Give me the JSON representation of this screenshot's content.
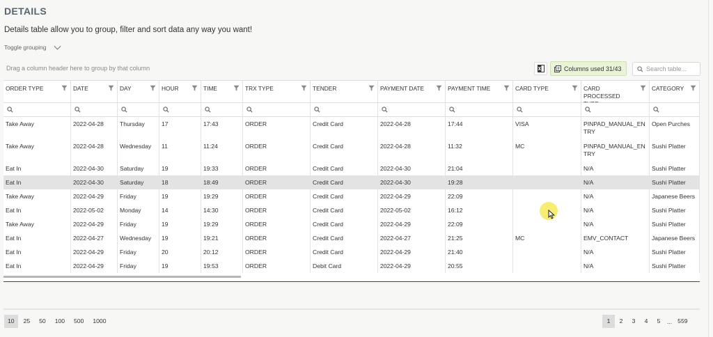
{
  "page": {
    "title": "DETAILS",
    "subtitle": "Details table allow you to group, filter and sort data any way you want!",
    "toggle_label": "Toggle grouping"
  },
  "toolbar": {
    "group_hint": "Drag a column header here to group by that column",
    "columns_label": "Columns used 31/43",
    "search_placeholder": "Search table..."
  },
  "columns": [
    {
      "label": "ORDER TYPE"
    },
    {
      "label": "DATE"
    },
    {
      "label": "DAY"
    },
    {
      "label": "HOUR"
    },
    {
      "label": "TIME"
    },
    {
      "label": "TRX TYPE"
    },
    {
      "label": "TENDER"
    },
    {
      "label": "PAYMENT DATE"
    },
    {
      "label": "PAYMENT TIME"
    },
    {
      "label": "CARD TYPE"
    },
    {
      "label": "CARD PROCESSED TYPE"
    },
    {
      "label": "CATEGORY"
    }
  ],
  "rows": [
    [
      "Take Away",
      "2022-04-28",
      "Thursday",
      "17",
      "17:43",
      "ORDER",
      "Credit Card",
      "2022-04-28",
      "17:44",
      "VISA",
      "PINPAD_MANUAL_ENTRY",
      "Open Purches"
    ],
    [
      "Take Away",
      "2022-04-28",
      "Wednesday",
      "11",
      "11:24",
      "ORDER",
      "Credit Card",
      "2022-04-28",
      "11:32",
      "MC",
      "PINPAD_MANUAL_ENTRY",
      "Sushi Platter"
    ],
    [
      "Eat In",
      "2022-04-30",
      "Saturday",
      "19",
      "19:33",
      "ORDER",
      "Credit Card",
      "2022-04-30",
      "21:04",
      "",
      "N/A",
      "Sushi Platter"
    ],
    [
      "Eat In",
      "2022-04-30",
      "Saturday",
      "18",
      "18:49",
      "ORDER",
      "Credit Card",
      "2022-04-30",
      "19:28",
      "",
      "N/A",
      "Sushi Platter"
    ],
    [
      "Take Away",
      "2022-04-29",
      "Friday",
      "19",
      "19:29",
      "ORDER",
      "Credit Card",
      "2022-04-29",
      "22:09",
      "",
      "N/A",
      "Japanese Beers"
    ],
    [
      "Eat In",
      "2022-05-02",
      "Monday",
      "14",
      "14:30",
      "ORDER",
      "Credit Card",
      "2022-05-02",
      "16:12",
      "",
      "N/A",
      "Sushi Platter"
    ],
    [
      "Take Away",
      "2022-04-29",
      "Friday",
      "19",
      "19:29",
      "ORDER",
      "Credit Card",
      "2022-04-29",
      "22:09",
      "",
      "N/A",
      "Sushi Platter"
    ],
    [
      "Eat In",
      "2022-04-27",
      "Wednesday",
      "19",
      "19:21",
      "ORDER",
      "Credit Card",
      "2022-04-27",
      "21:25",
      "MC",
      "EMV_CONTACT",
      "Japanese Beers"
    ],
    [
      "Eat In",
      "2022-04-29",
      "Friday",
      "20",
      "20:12",
      "ORDER",
      "Credit Card",
      "2022-04-29",
      "21:40",
      "",
      "N/A",
      "Sushi Platter"
    ],
    [
      "Eat In",
      "2022-04-29",
      "Friday",
      "19",
      "19:53",
      "ORDER",
      "Debit Card",
      "2022-04-29",
      "20:55",
      "",
      "N/A",
      "Sushi Platter"
    ]
  ],
  "selected_row": 3,
  "pagination": {
    "page_sizes": [
      "10",
      "25",
      "50",
      "100",
      "500",
      "1000"
    ],
    "active_size": "10",
    "pages": [
      "1",
      "2",
      "3",
      "4",
      "5"
    ],
    "ellipsis": "...",
    "last_page": "559",
    "active_page": "1"
  },
  "icons": {
    "filter": "filter-icon",
    "search": "search-icon",
    "excel": "excel-export-icon",
    "columns": "columns-icon",
    "chevron": "chevron-down-icon"
  },
  "colors": {
    "columns_button_bg": "#e8f3d8",
    "selected_row_bg": "#e3e3e3",
    "cursor_highlight": "#f6e850"
  }
}
